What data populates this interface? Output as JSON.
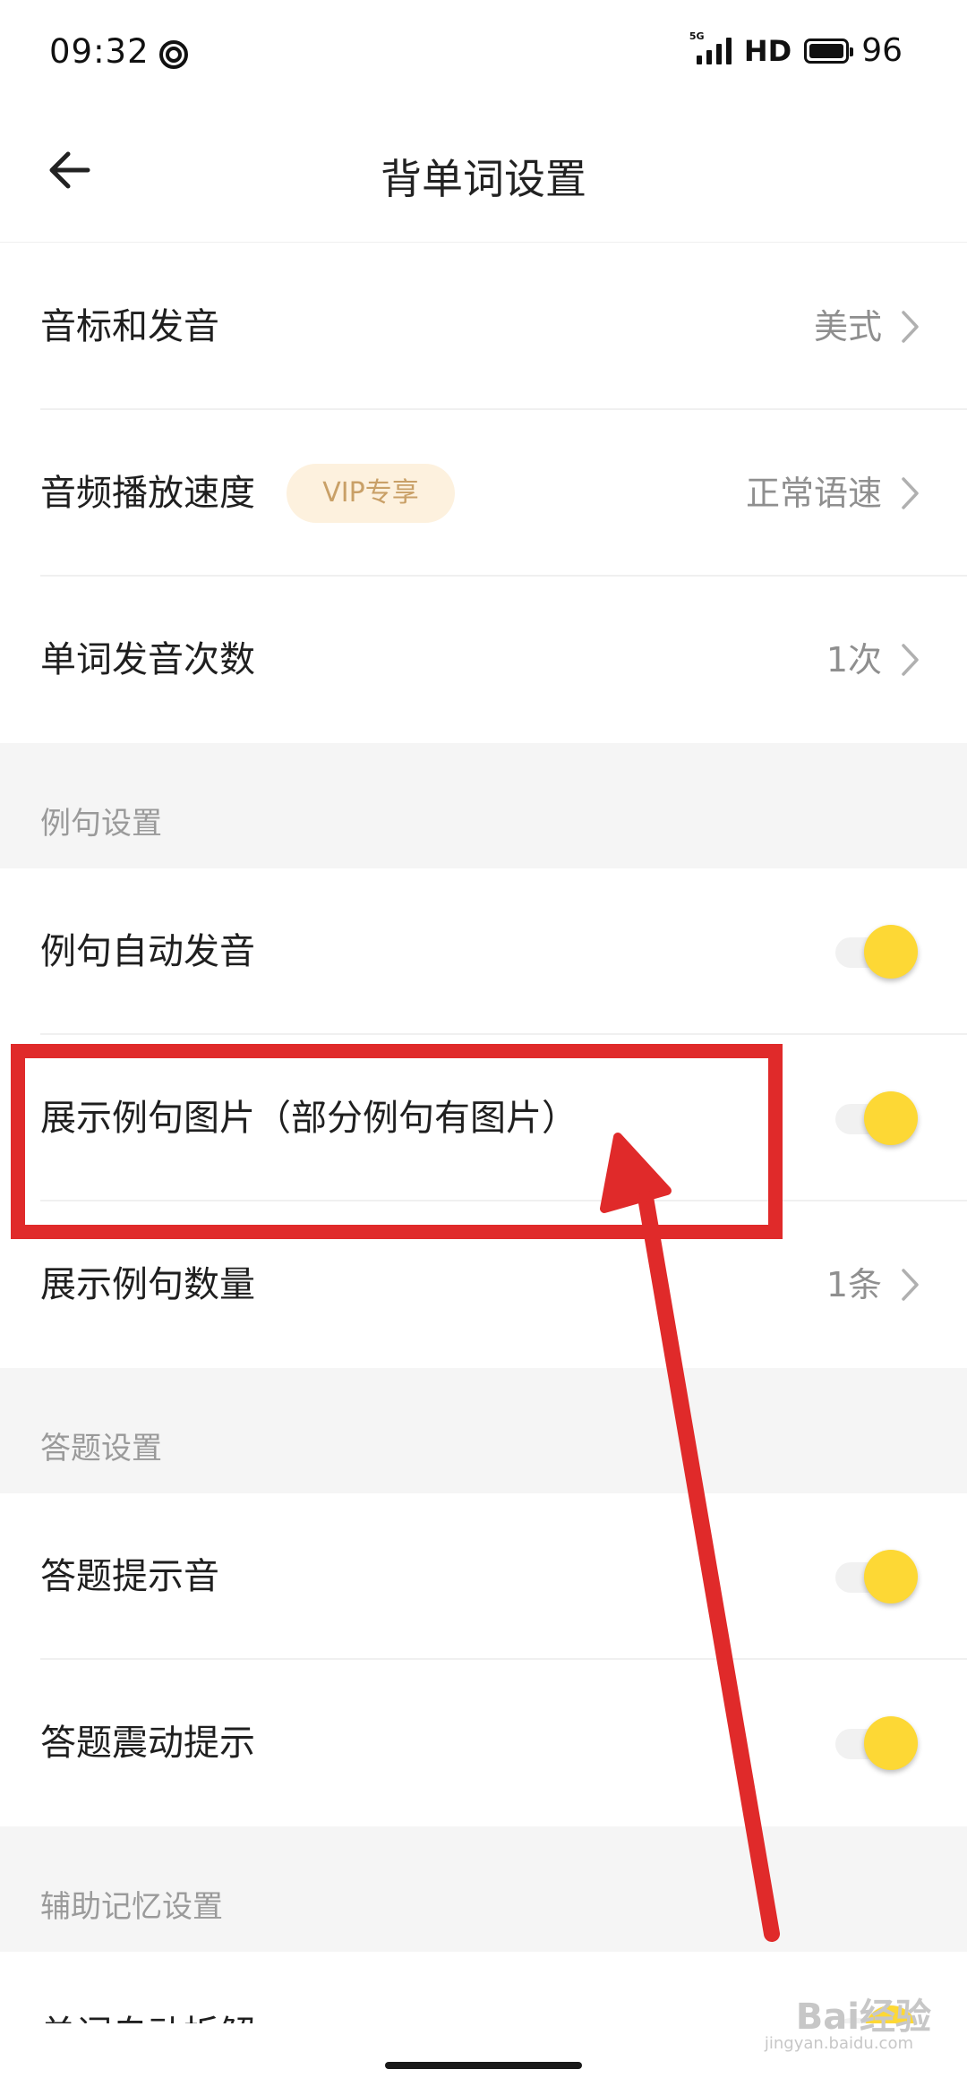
{
  "status_bar": {
    "time": "09:32",
    "network": "5G",
    "hd": "HD",
    "battery": "96"
  },
  "nav": {
    "title": "背单词设置"
  },
  "rows": [
    {
      "label": "音标和发音",
      "value": "美式"
    },
    {
      "label": "音频播放速度",
      "badge": "VIP专享",
      "value": "正常语速"
    },
    {
      "label": "单词发音次数",
      "value": "1次"
    }
  ],
  "sections": {
    "example": {
      "title": "例句设置",
      "rows": [
        {
          "label": "例句自动发音",
          "toggle_on": true
        },
        {
          "label": "展示例句图片（部分例句有图片）",
          "toggle_on": true
        },
        {
          "label": "展示例句数量",
          "value": "1条"
        }
      ]
    },
    "answer": {
      "title": "答题设置",
      "rows": [
        {
          "label": "答题提示音",
          "toggle_on": true
        },
        {
          "label": "答题震动提示",
          "toggle_on": true
        }
      ]
    },
    "memory": {
      "title": "辅助记忆设置",
      "rows": [
        {
          "label": "单词自动拆解",
          "toggle_on": true
        }
      ]
    }
  },
  "colors": {
    "toggle_knob": "#fdd835",
    "highlight": "#e02a2a",
    "vip_bg": "#fdf1de",
    "vip_text": "#c9a067"
  },
  "watermark": {
    "brand": "Bai经验",
    "url": "jingyan.baidu.com"
  }
}
